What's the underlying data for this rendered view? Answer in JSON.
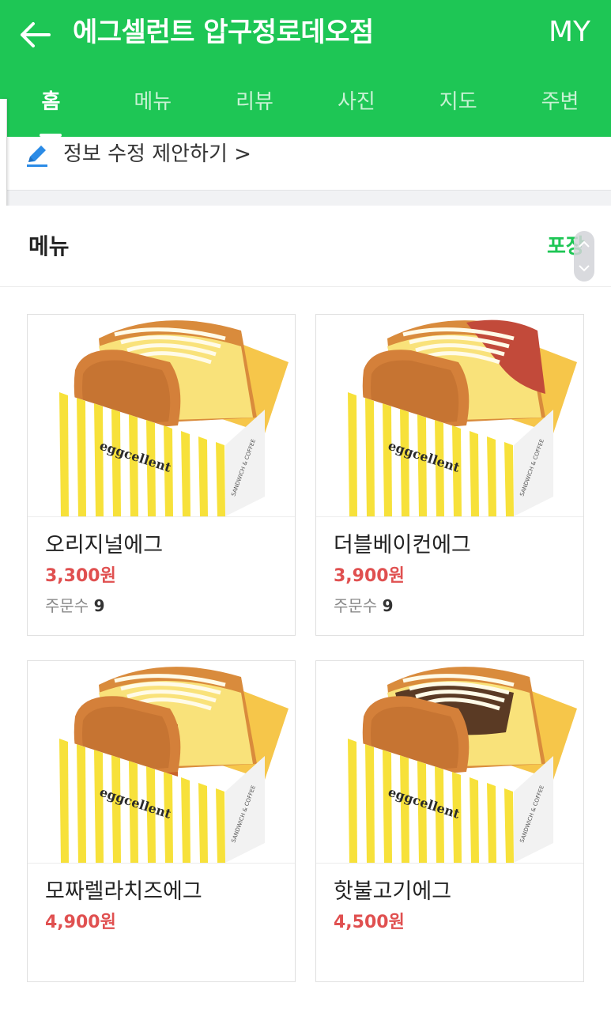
{
  "header": {
    "title": "에그셀런트 압구정로데오점",
    "my_label": "MY"
  },
  "tabs": [
    {
      "label": "홈",
      "active": true
    },
    {
      "label": "메뉴",
      "active": false
    },
    {
      "label": "리뷰",
      "active": false
    },
    {
      "label": "사진",
      "active": false
    },
    {
      "label": "지도",
      "active": false
    },
    {
      "label": "주변",
      "active": false
    }
  ],
  "edit_suggestion": {
    "label": "정보 수정 제안하기 >"
  },
  "menu": {
    "title": "메뉴",
    "takeout_label": "포장",
    "box_brand": "eggcellent",
    "box_tagline": "SANDWICH & COFFEE",
    "orders_prefix": "주문수",
    "items": [
      {
        "name": "오리지널에그",
        "price": "3,300원",
        "orders": "9",
        "filling": "plain"
      },
      {
        "name": "더블베이컨에그",
        "price": "3,900원",
        "orders": "9",
        "filling": "bacon"
      },
      {
        "name": "모짜렐라치즈에그",
        "price": "4,900원",
        "orders": "",
        "filling": "mozzarella"
      },
      {
        "name": "핫불고기에그",
        "price": "4,500원",
        "orders": "",
        "filling": "bulgogi"
      }
    ]
  },
  "colors": {
    "brand_green": "#1ec655",
    "price_red": "#e05050",
    "box_yellow": "#f7e13a"
  }
}
